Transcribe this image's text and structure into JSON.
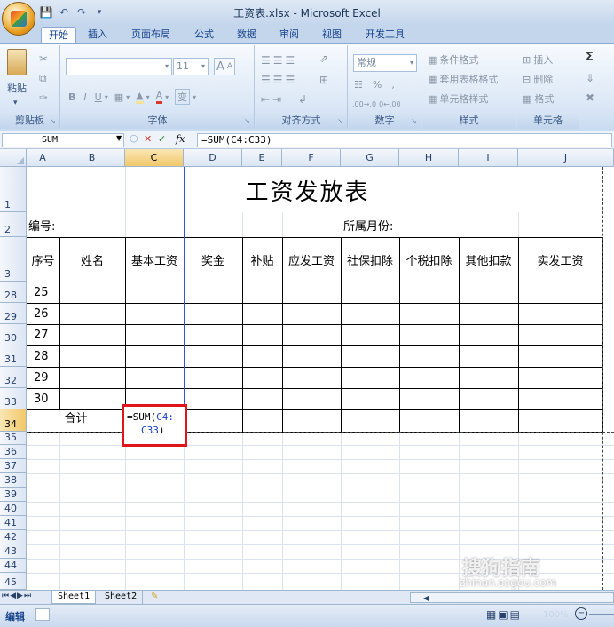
{
  "window": {
    "title": "工资表.xlsx - Microsoft Excel"
  },
  "ribbon_tabs": [
    "开始",
    "插入",
    "页面布局",
    "公式",
    "数据",
    "审阅",
    "视图",
    "开发工具"
  ],
  "ribbon": {
    "clipboard": {
      "label": "剪贴板",
      "paste": "粘贴"
    },
    "font": {
      "label": "字体",
      "size": "11",
      "bold": "B",
      "italic": "I",
      "underline": "U",
      "grow": "A",
      "shrink": "A"
    },
    "alignment": {
      "label": "对齐方式"
    },
    "number": {
      "label": "数字",
      "format": "常规",
      "percent": "%",
      "comma": ",",
      "inc_decimal": ".00→.0",
      "dec_decimal": "0←.00"
    },
    "styles": {
      "label": "样式",
      "conditional": "条件格式",
      "table": "套用表格格式",
      "cell": "单元格样式"
    },
    "cells": {
      "label": "单元格",
      "insert": "插入",
      "delete": "删除",
      "format": "格式"
    },
    "editing": {
      "sigma": "Σ"
    }
  },
  "formula_bar": {
    "name_box": "SUM",
    "cancel": "✕",
    "enter": "✓",
    "fx": "fx",
    "formula": "=SUM(C4:C33)"
  },
  "columns": [
    "A",
    "B",
    "C",
    "D",
    "E",
    "F",
    "G",
    "H",
    "I",
    "J"
  ],
  "rows": [
    "1",
    "2",
    "3",
    "28",
    "29",
    "30",
    "31",
    "32",
    "33",
    "34",
    "35",
    "36",
    "37",
    "38",
    "39",
    "40",
    "41",
    "42",
    "43",
    "44",
    "45"
  ],
  "sheet": {
    "title": "工资发放表",
    "number_label": "编号:",
    "month_label": "所属月份:",
    "headers": [
      "序号",
      "姓名",
      "基本工资",
      "奖金",
      "补贴",
      "应发工资",
      "社保扣除",
      "个税扣除",
      "其他扣款",
      "实发工资"
    ],
    "seq_values": [
      "25",
      "26",
      "27",
      "28",
      "29",
      "30"
    ],
    "total_label": "合计",
    "editing_prefix": "=SUM(",
    "editing_ref_1": "C4:",
    "editing_ref_2": "C33",
    "editing_suffix": ")"
  },
  "sheet_tabs": [
    "Sheet1",
    "Sheet2"
  ],
  "status": {
    "mode": "编辑",
    "zoom": "100%"
  },
  "watermark": {
    "text_1": "搜狗指南",
    "text_2": "zhinan.sogou.com"
  },
  "colors": {
    "accent": "#2e74c9",
    "highlight_box": "#e0151b",
    "ref_blue": "#1a3fd0"
  }
}
